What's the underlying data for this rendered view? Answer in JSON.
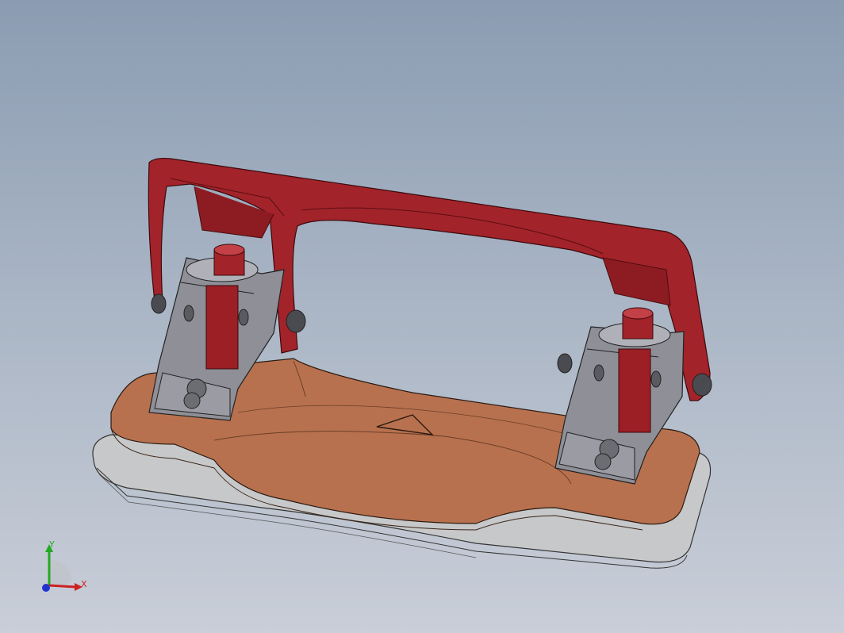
{
  "viewport": {
    "background_top": "#8b9cb2",
    "background_bottom": "#c9ced8"
  },
  "model": {
    "part_colors": {
      "handle": "#a3232a",
      "plunger": "#9b1f24",
      "base": "#b8714e",
      "base_plate": "#c9c9c9",
      "brackets": "#8e8f97"
    }
  },
  "triad": {
    "x_label": "X",
    "y_label": "Y",
    "x_color": "#cc2222",
    "y_color": "#22aa22",
    "z_color": "#2233cc"
  }
}
